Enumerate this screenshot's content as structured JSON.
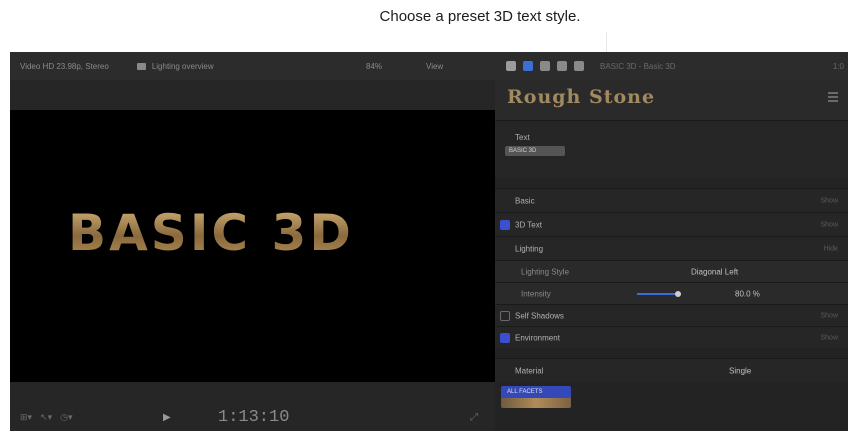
{
  "callout": {
    "text": "Choose a preset 3D text style."
  },
  "viewer": {
    "format": "Video HD 23.98p, Stereo",
    "view_name": "Lighting overview",
    "zoom": "84%",
    "view_menu": "View",
    "canvas_text": "BASIC 3D",
    "timecode": "1:13:10",
    "play_icon": "play-icon"
  },
  "inspector": {
    "title": "BASIC 3D - Basic 3D",
    "right_value": "1:0",
    "preset": {
      "name": "Rough Stone"
    },
    "text_section": {
      "label": "Text",
      "field_value": "BASIC 3D"
    },
    "rows": {
      "basic": {
        "label": "Basic",
        "show": "Show"
      },
      "text3d": {
        "label": "3D Text",
        "show": "Show"
      },
      "lighting": {
        "label": "Lighting",
        "show": "Hide"
      },
      "lighting_style": {
        "label": "Lighting Style",
        "value": "Diagonal Left"
      },
      "intensity": {
        "label": "Intensity",
        "value": "80.0 %"
      },
      "self_shadows": {
        "label": "Self Shadows",
        "show": "Show"
      },
      "environment": {
        "label": "Environment",
        "show": "Show"
      },
      "material": {
        "label": "Material",
        "value": "Single"
      }
    },
    "swatch_label": "ALL FACETS"
  },
  "colors": {
    "accent": "#3c4fd0",
    "gold": "#b08c58"
  }
}
